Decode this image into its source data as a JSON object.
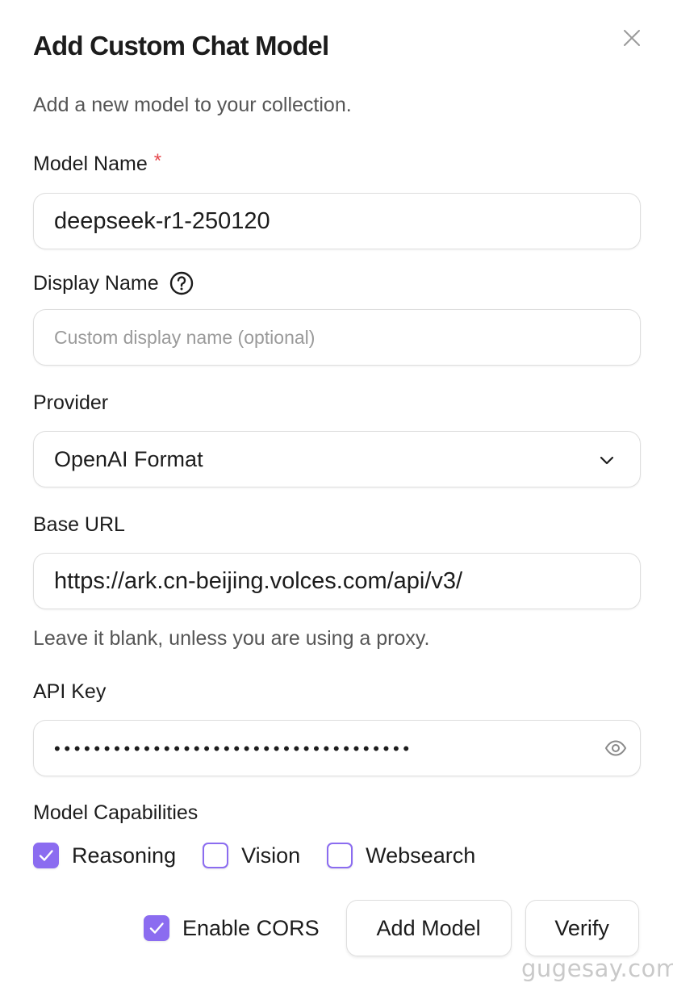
{
  "dialog": {
    "title": "Add Custom Chat Model",
    "subtitle": "Add a new model to your collection.",
    "close_icon": "close-icon"
  },
  "fields": {
    "model_name": {
      "label": "Model Name",
      "required_marker": "*",
      "value": "deepseek-r1-250120"
    },
    "display_name": {
      "label": "Display Name",
      "help_icon": "question-circle-icon",
      "value": "",
      "placeholder": "Custom display name (optional)"
    },
    "provider": {
      "label": "Provider",
      "selected": "OpenAI Format",
      "icon": "chevron-down-icon"
    },
    "base_url": {
      "label": "Base URL",
      "value": "https://ark.cn-beijing.volces.com/api/v3/",
      "hint": "Leave it blank, unless you are using a proxy."
    },
    "api_key": {
      "label": "API Key",
      "masked_value": "••••••••••••••••••••••••••••••••••••",
      "icon": "eye-icon"
    }
  },
  "capabilities": {
    "label": "Model Capabilities",
    "items": [
      {
        "label": "Reasoning",
        "checked": true
      },
      {
        "label": "Vision",
        "checked": false
      },
      {
        "label": "Websearch",
        "checked": false
      }
    ]
  },
  "footer": {
    "cors": {
      "label": "Enable CORS",
      "checked": true
    },
    "add_button": "Add Model",
    "verify_button": "Verify"
  },
  "watermark": "gugesay.com",
  "colors": {
    "accent": "#8b6cf0",
    "required": "#e5484d"
  }
}
